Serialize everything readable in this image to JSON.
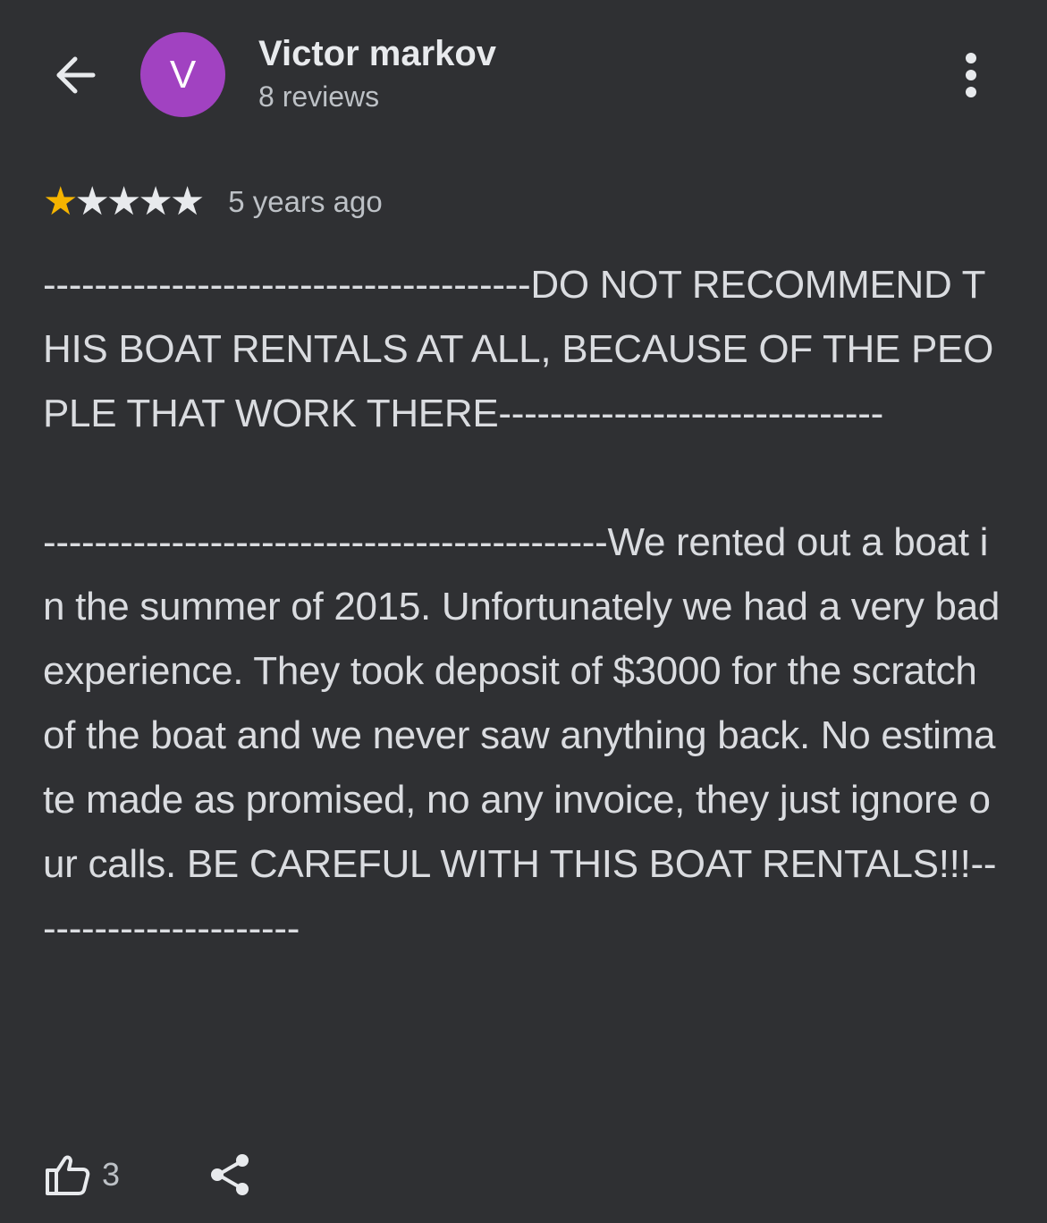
{
  "header": {
    "back_icon": "arrow-left-icon",
    "avatar_letter": "V",
    "avatar_color": "#a142c1",
    "reviewer_name": "Victor markov",
    "review_count": "8 reviews",
    "more_icon": "more-vertical-icon"
  },
  "review": {
    "rating": 1,
    "rating_max": 5,
    "star_color": "#f5b400",
    "time_ago": "5 years ago",
    "paragraphs": [
      "--------------------------------------DO NOT RECOMMEND THIS BOAT RENTALS AT ALL, BECAUSE OF THE PEOPLE THAT WORK THERE------------------------------",
      "--------------------------------------------We rented out a boat in the summer of 2015. Unfortunately we had a very bad experience. They took deposit of $3000 for the scratch of the boat and we never saw anything back. No estimate made as promised, no any invoice, they just ignore our calls. BE CAREFUL WITH THIS BOAT RENTALS!!!----------------------"
    ]
  },
  "actions": {
    "like_icon": "thumbs-up-icon",
    "like_count": "3",
    "share_icon": "share-icon"
  }
}
